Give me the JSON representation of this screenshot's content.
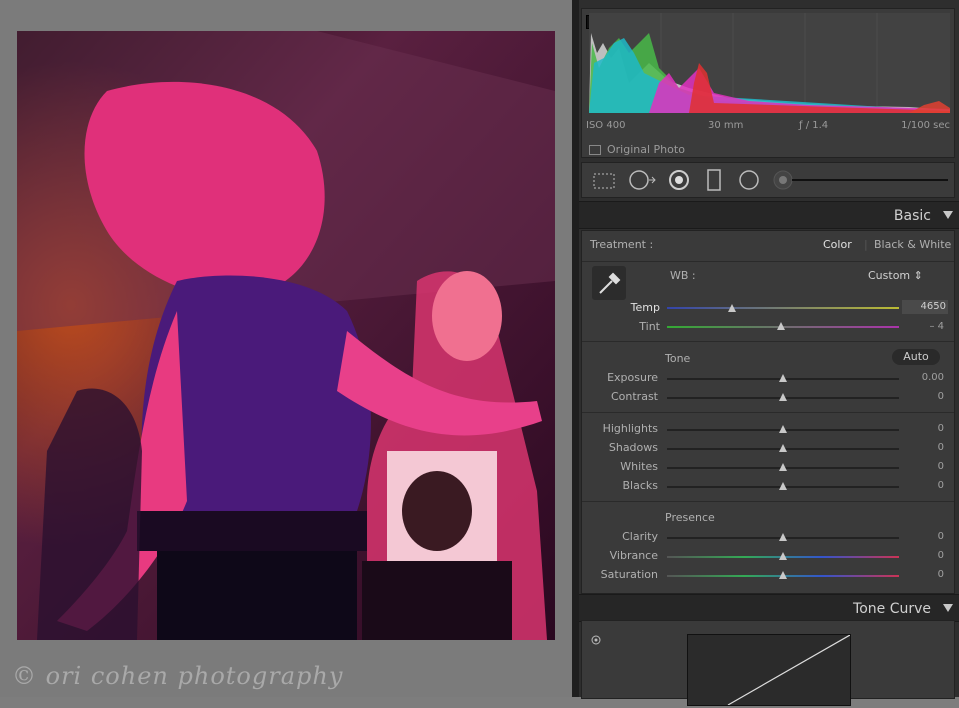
{
  "watermark": "© ori cohen photography",
  "histogram": {
    "exif": {
      "iso": "ISO 400",
      "focal": "30 mm",
      "aperture": "ƒ / 1.4",
      "shutter": "1/100 sec"
    },
    "original_photo_label": "Original Photo"
  },
  "basic": {
    "header": "Basic",
    "treatment_label": "Treatment :",
    "treatment_color": "Color",
    "treatment_bw": "Black & White",
    "wb_label": "WB :",
    "wb_value": "Custom ⇕",
    "temp": {
      "label": "Temp",
      "value": "4650",
      "position": 0.28
    },
    "tint": {
      "label": "Tint",
      "value": "– 4",
      "position": 0.49
    },
    "tone_label": "Tone",
    "auto_label": "Auto",
    "exposure": {
      "label": "Exposure",
      "value": "0.00",
      "position": 0.5
    },
    "contrast": {
      "label": "Contrast",
      "value": "0",
      "position": 0.5
    },
    "highlights": {
      "label": "Highlights",
      "value": "0",
      "position": 0.5
    },
    "shadows": {
      "label": "Shadows",
      "value": "0",
      "position": 0.5
    },
    "whites": {
      "label": "Whites",
      "value": "0",
      "position": 0.5
    },
    "blacks": {
      "label": "Blacks",
      "value": "0",
      "position": 0.5
    },
    "presence_label": "Presence",
    "clarity": {
      "label": "Clarity",
      "value": "0",
      "position": 0.5
    },
    "vibrance": {
      "label": "Vibrance",
      "value": "0",
      "position": 0.5
    },
    "saturation": {
      "label": "Saturation",
      "value": "0",
      "position": 0.5
    }
  },
  "tone_curve": {
    "header": "Tone Curve"
  },
  "colors": {
    "accent": "#15a8b5",
    "panel_bg": "#3a3a3a"
  }
}
